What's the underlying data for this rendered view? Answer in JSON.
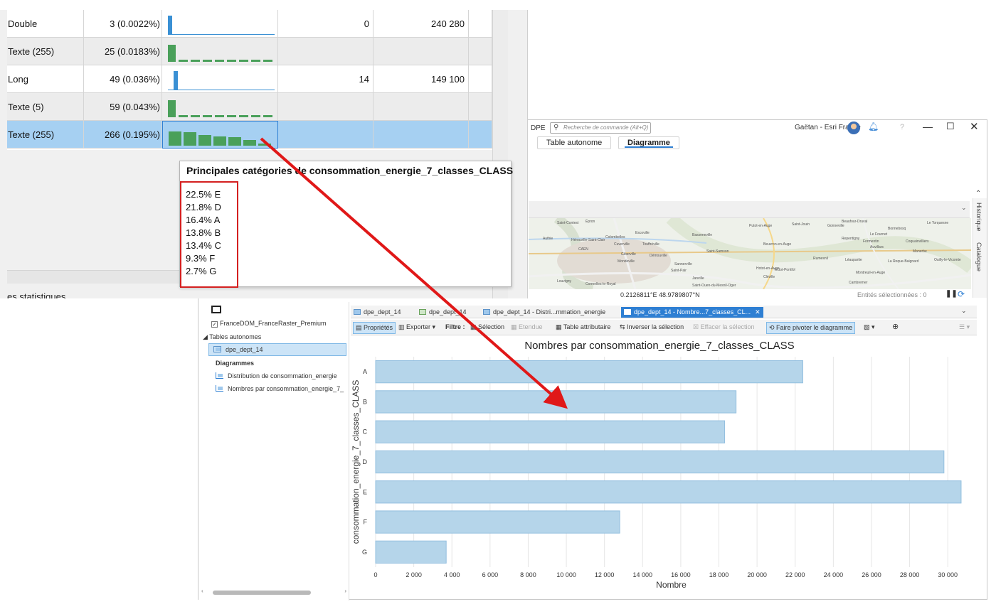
{
  "window": {
    "project": "DPE",
    "search_placeholder": "Recherche de commande (Alt+Q)",
    "user": "Gaëtan - Esri France",
    "minimize": "—",
    "maximize": "☐",
    "close": "✕"
  },
  "ribbon": {
    "tabs": [
      {
        "label": "Table autonome",
        "active": false
      },
      {
        "label": "Diagramme",
        "active": true
      }
    ]
  },
  "map": {
    "places": [
      "Saint-Contest",
      "Épron",
      "Colombelles",
      "Escoville",
      "Authie",
      "Hérouville-Saint-Clair",
      "Cuverville",
      "Touffréville",
      "CAEN",
      "Giberville",
      "Démouville",
      "Mondeville",
      "Sannerville",
      "Saint-Samson",
      "Basseneville",
      "Putot-en-Auge",
      "Saint-Jouin",
      "Beuvron-en-Auge",
      "Gonneville",
      "Le Fournet",
      "Repentigny",
      "Formentin",
      "Coquainvilliers",
      "Auvillars",
      "Manerbe",
      "Rumesnil",
      "Léaupartie",
      "La Roque-Baignard",
      "Ouilly-le-Vicomte",
      "Cormelles-le-Royal",
      "Saint-Pair",
      "Janville",
      "Victot-Pontfol",
      "Montreuil-en-Auge",
      "Cambremer",
      "Louvigny",
      "Saint-Ouen-du-Mesnil-Oger",
      "Le Torquesne",
      "Bonnebosq",
      "Hotot-en-Auge",
      "Cléville",
      "Beaufour-Druval"
    ],
    "coordinates": "0.2126811°E 48.9789807°N",
    "selected_features": "Entités sélectionnées : 0",
    "side_tabs": [
      "Historique",
      "Catalogue"
    ]
  },
  "contents": {
    "basemap_item": "FranceDOM_FranceRaster_Premium",
    "basemap_checked": true,
    "group_tables": "Tables autonomes",
    "table_item": "dpe_dept_14",
    "group_charts": "Diagrammes",
    "chart_items": [
      "Distribution de consommation_energie",
      "Nombres par consommation_energie_7_"
    ]
  },
  "view_tabs": [
    {
      "label": "dpe_dept_14",
      "active": false
    },
    {
      "label": "dpe_dept_14",
      "active": false
    },
    {
      "label": "dpe_dept_14 - Distri...mmation_energie",
      "active": false
    },
    {
      "label": "dpe_dept_14 - Nombre...7_classes_CL...",
      "active": true,
      "close": "✕"
    }
  ],
  "toolbar": {
    "properties": "Propriétés",
    "export": "Exporter",
    "filter": "Filtre :",
    "selection": "Sélection",
    "extent": "Etendue",
    "attribute_table": "Table attributaire",
    "invert_selection": "Inverser la sélection",
    "clear_selection": "Effacer la sélection",
    "rotate_chart": "Faire pivoter le diagramme"
  },
  "stats_table": {
    "rows": [
      {
        "type": "Double",
        "nulls": "3 (0.0022%)",
        "min": "0",
        "max": "240 280",
        "mini": "dist-double",
        "selected": false,
        "alt": false
      },
      {
        "type": "Texte (255)",
        "nulls": "25 (0.0183%)",
        "min": "",
        "max": "",
        "mini": "cat-flat",
        "selected": false,
        "alt": true
      },
      {
        "type": "Long",
        "nulls": "49 (0.036%)",
        "min": "14",
        "max": "149 100",
        "mini": "dist-long",
        "selected": false,
        "alt": false
      },
      {
        "type": "Texte (5)",
        "nulls": "59 (0.043%)",
        "min": "",
        "max": "",
        "mini": "cat-flat",
        "selected": false,
        "alt": true
      },
      {
        "type": "Texte (255)",
        "nulls": "266 (0.195%)",
        "min": "",
        "max": "",
        "mini": "cat-classes",
        "selected": true,
        "alt": false
      }
    ],
    "caption": "es statistiques"
  },
  "tooltip": {
    "title": "Principales catégories de consommation_energie_7_classes_CLASS",
    "items": [
      "22.5% E",
      "21.8% D",
      "16.4% A",
      "13.8% B",
      "13.4% C",
      "9.3% F",
      "2.7% G"
    ]
  },
  "colors": {
    "bar_fill": "#b5d5ea",
    "bar_stroke": "#93bfdf",
    "mini_green": "#4aa05a",
    "mini_blue": "#3a90d4",
    "selection_blue": "#a6d0f2",
    "accent": "#2e7fd3",
    "arrow": "#e01818",
    "highlight_box": "#d42020"
  },
  "chart_data": {
    "type": "bar",
    "orientation": "horizontal",
    "title": "Nombres par consommation_energie_7_classes_CLASS",
    "xlabel": "Nombre",
    "ylabel": "consommation_energie_7_classes_CLASS",
    "categories": [
      "A",
      "B",
      "C",
      "D",
      "E",
      "F",
      "G"
    ],
    "values": [
      22400,
      18900,
      18300,
      29800,
      30700,
      12800,
      3700
    ],
    "xlim": [
      0,
      31000
    ],
    "x_ticks": [
      0,
      2000,
      4000,
      6000,
      8000,
      10000,
      12000,
      14000,
      16000,
      18000,
      20000,
      22000,
      24000,
      26000,
      28000,
      30000
    ],
    "x_tick_labels": [
      "0",
      "2 000",
      "4 000",
      "6 000",
      "8 000",
      "10 000",
      "12 000",
      "14 000",
      "16 000",
      "18 000",
      "20 000",
      "22 000",
      "24 000",
      "26 000",
      "28 000",
      "30 000"
    ],
    "grid": true,
    "legend": "none"
  }
}
